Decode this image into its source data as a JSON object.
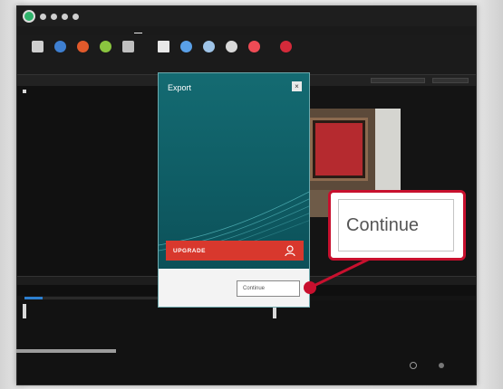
{
  "window": {
    "title": "",
    "right_label": ""
  },
  "menu": {
    "tabs": [
      "",
      "",
      "",
      "",
      "",
      "",
      "",
      ""
    ],
    "active_index": 5
  },
  "ribbon": {
    "buttons": [
      {
        "icon": "computer-icon",
        "color": "#cfcfcf"
      },
      {
        "icon": "globe-icon",
        "color": "#3e7fd1"
      },
      {
        "icon": "apple-icon",
        "color": "#e25a2b"
      },
      {
        "icon": "android-icon",
        "color": "#8ac53f"
      },
      {
        "icon": "device-icon",
        "color": "#bfbfbf"
      },
      {
        "icon": "tv-icon",
        "color": "#e8e8e8"
      },
      {
        "icon": "cloud-icon",
        "color": "#5aa0e8"
      },
      {
        "icon": "disc-icon",
        "color": "#9fc4e8"
      },
      {
        "icon": "eye-icon",
        "color": "#d9d9d9"
      },
      {
        "icon": "share-icon",
        "color": "#ef4b55"
      },
      {
        "icon": "record-icon",
        "color": "#d42a3a"
      }
    ]
  },
  "export_dialog": {
    "title": "Export",
    "close_label": "×",
    "upgrade_label": "UPGRADE",
    "footer_text": "",
    "continue_label": "Continue"
  },
  "callout": {
    "continue_label": "Continue",
    "accent": "#c8102e"
  },
  "timeline": {
    "progress": 0.12
  },
  "colors": {
    "dialog_teal": "#146b72",
    "upgrade_red": "#d8382d",
    "background": "#141414"
  }
}
